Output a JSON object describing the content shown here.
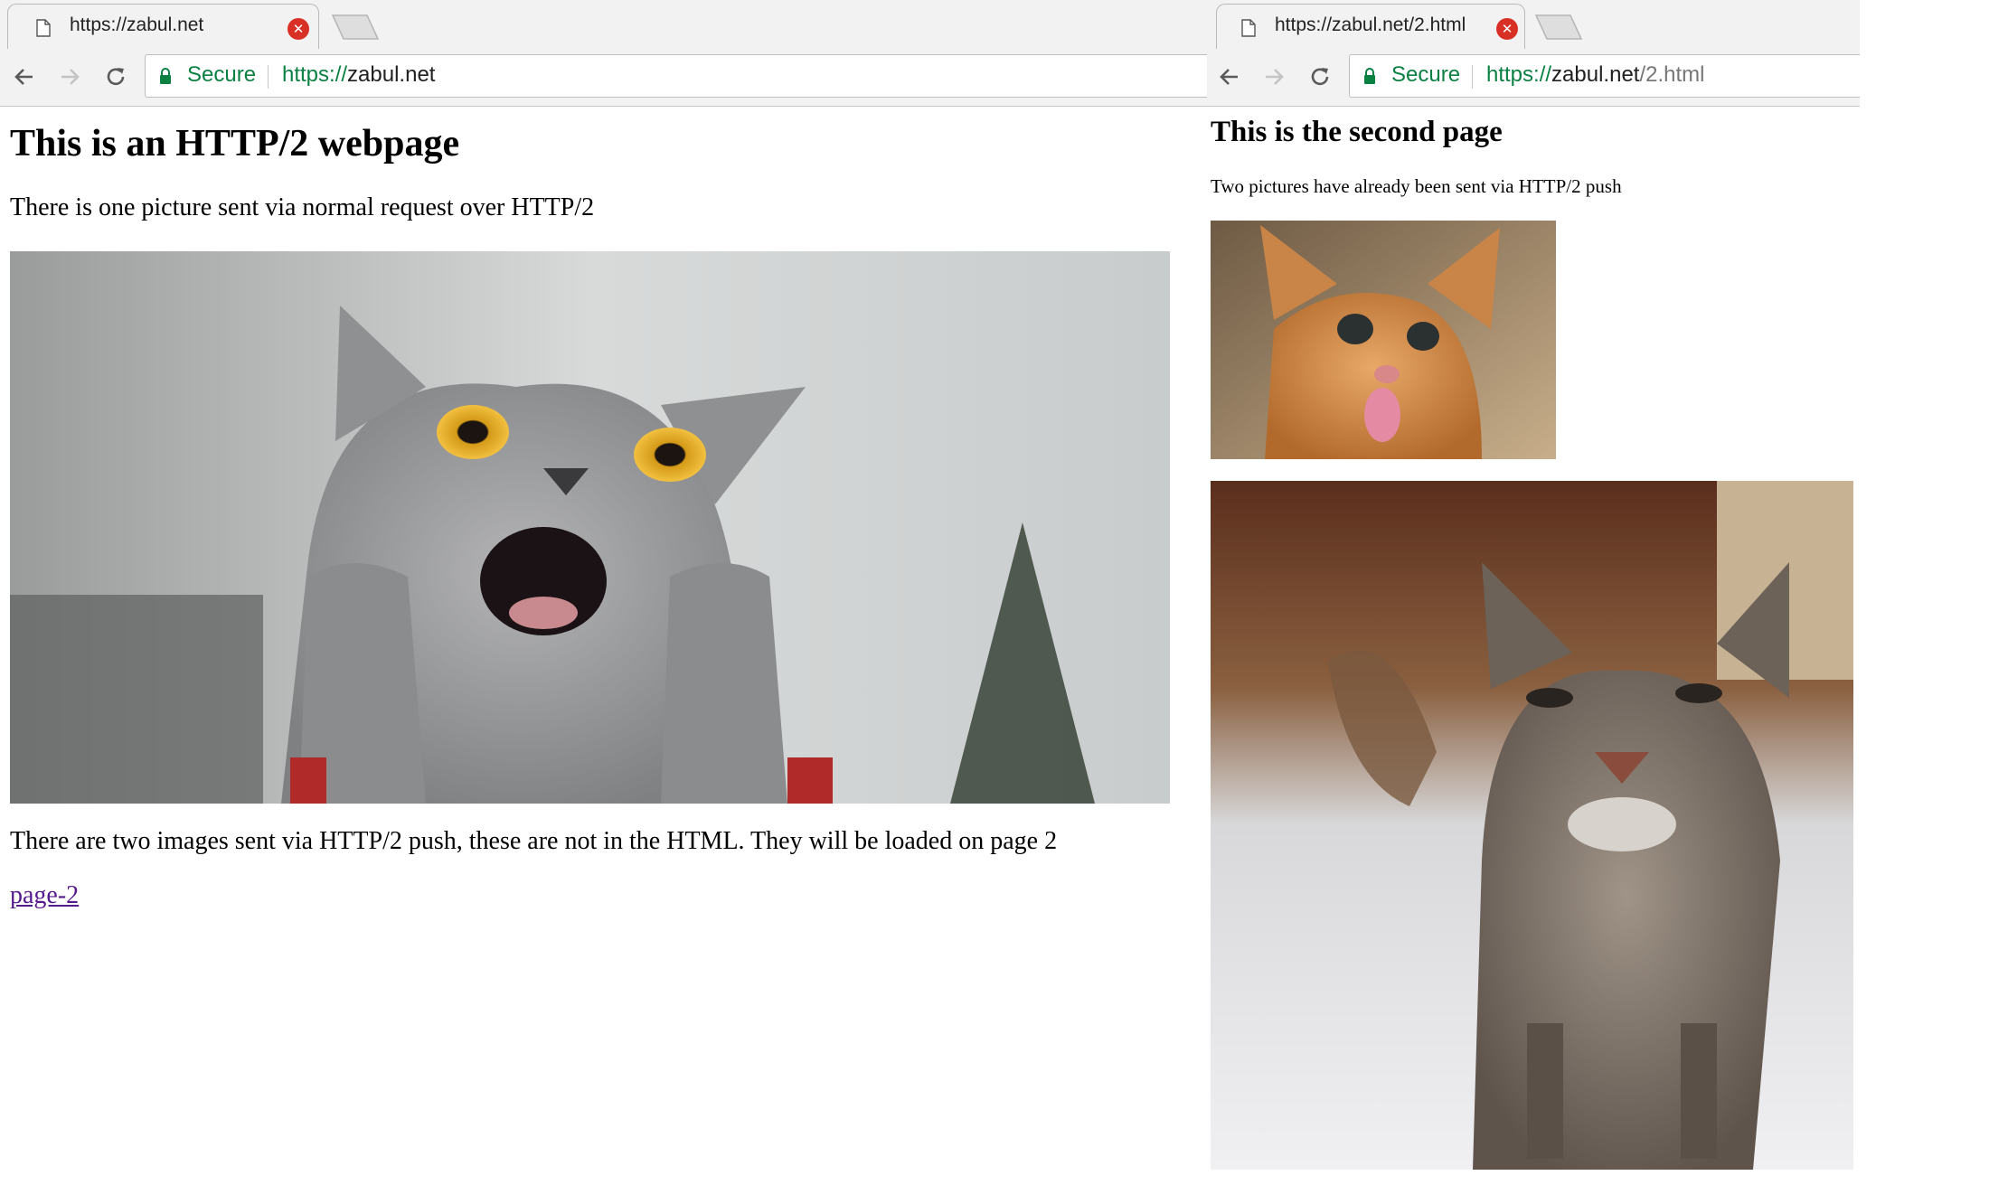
{
  "left_window": {
    "tab_title": "https://zabul.net",
    "omnibox": {
      "secure_label": "Secure",
      "url_scheme": "https://",
      "url_host": "zabul.net",
      "url_path": ""
    },
    "page": {
      "heading": "This is an HTTP/2 webpage",
      "intro": "There is one picture sent via normal request over HTTP/2",
      "note": "There are two images sent via HTTP/2 push, these are not in the HTML. They will be loaded on page 2",
      "link_label": "page-2"
    }
  },
  "right_window": {
    "tab_title": "https://zabul.net/2.html",
    "omnibox": {
      "secure_label": "Secure",
      "url_scheme": "https://",
      "url_host": "zabul.net",
      "url_path": "/2.html"
    },
    "page": {
      "heading": "This is the second page",
      "intro": "Two pictures have already been sent via HTTP/2 push"
    }
  },
  "colors": {
    "secure_green": "#0b8043",
    "close_red": "#d93025",
    "visited_link": "#551a8b"
  },
  "icons": [
    "page-icon",
    "close-icon",
    "back-arrow-icon",
    "forward-arrow-icon",
    "reload-icon",
    "lock-icon"
  ]
}
